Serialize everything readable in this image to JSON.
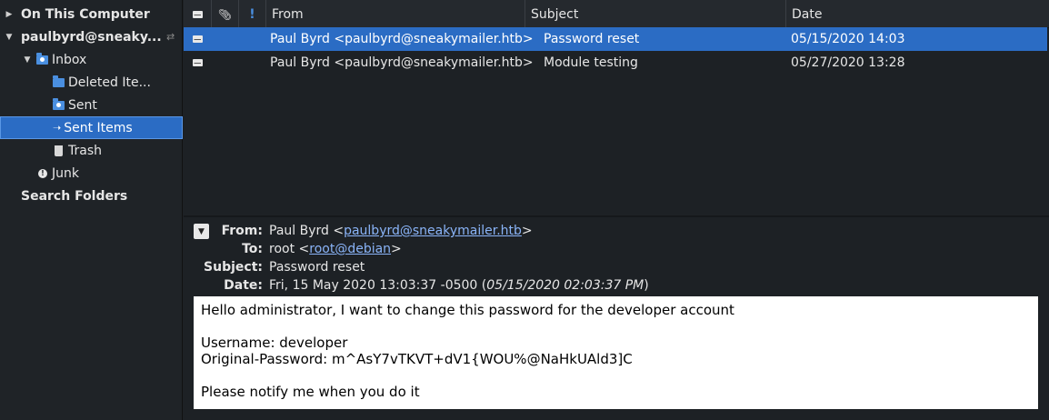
{
  "sidebar": {
    "on_this_computer": "On This Computer",
    "account": "paulbyrd@sneaky...",
    "inbox": "Inbox",
    "deleted_items": "Deleted Ite...",
    "sent": "Sent",
    "sent_items": "Sent Items",
    "trash": "Trash",
    "junk": "Junk",
    "search_folders": "Search Folders"
  },
  "message_list": {
    "columns": {
      "from": "From",
      "subject": "Subject",
      "date": "Date"
    },
    "rows": [
      {
        "from": "Paul Byrd <paulbyrd@sneakymailer.htb>",
        "subject": "Password reset",
        "date": "05/15/2020 14:03"
      },
      {
        "from": "Paul Byrd <paulbyrd@sneakymailer.htb>",
        "subject": "Module testing",
        "date": "05/27/2020 13:28"
      }
    ]
  },
  "preview": {
    "labels": {
      "from": "From:",
      "to": "To:",
      "subject": "Subject:",
      "date": "Date:"
    },
    "from_name": "Paul Byrd <",
    "from_email": "paulbyrd@sneakymailer.htb",
    "from_close": ">",
    "to_name": "root <",
    "to_email": "root@debian",
    "to_close": ">",
    "subject": "Password reset",
    "date": "Fri, 15 May 2020 13:03:37 -0500 (",
    "date_local": "05/15/2020 02:03:37 PM",
    "date_close": ")",
    "body": "Hello administrator, I want to change this password for the developer account\n\nUsername: developer\nOriginal-Password: m^AsY7vTKVT+dV1{WOU%@NaHkUAld3]C\n\nPlease notify me when you do it"
  }
}
